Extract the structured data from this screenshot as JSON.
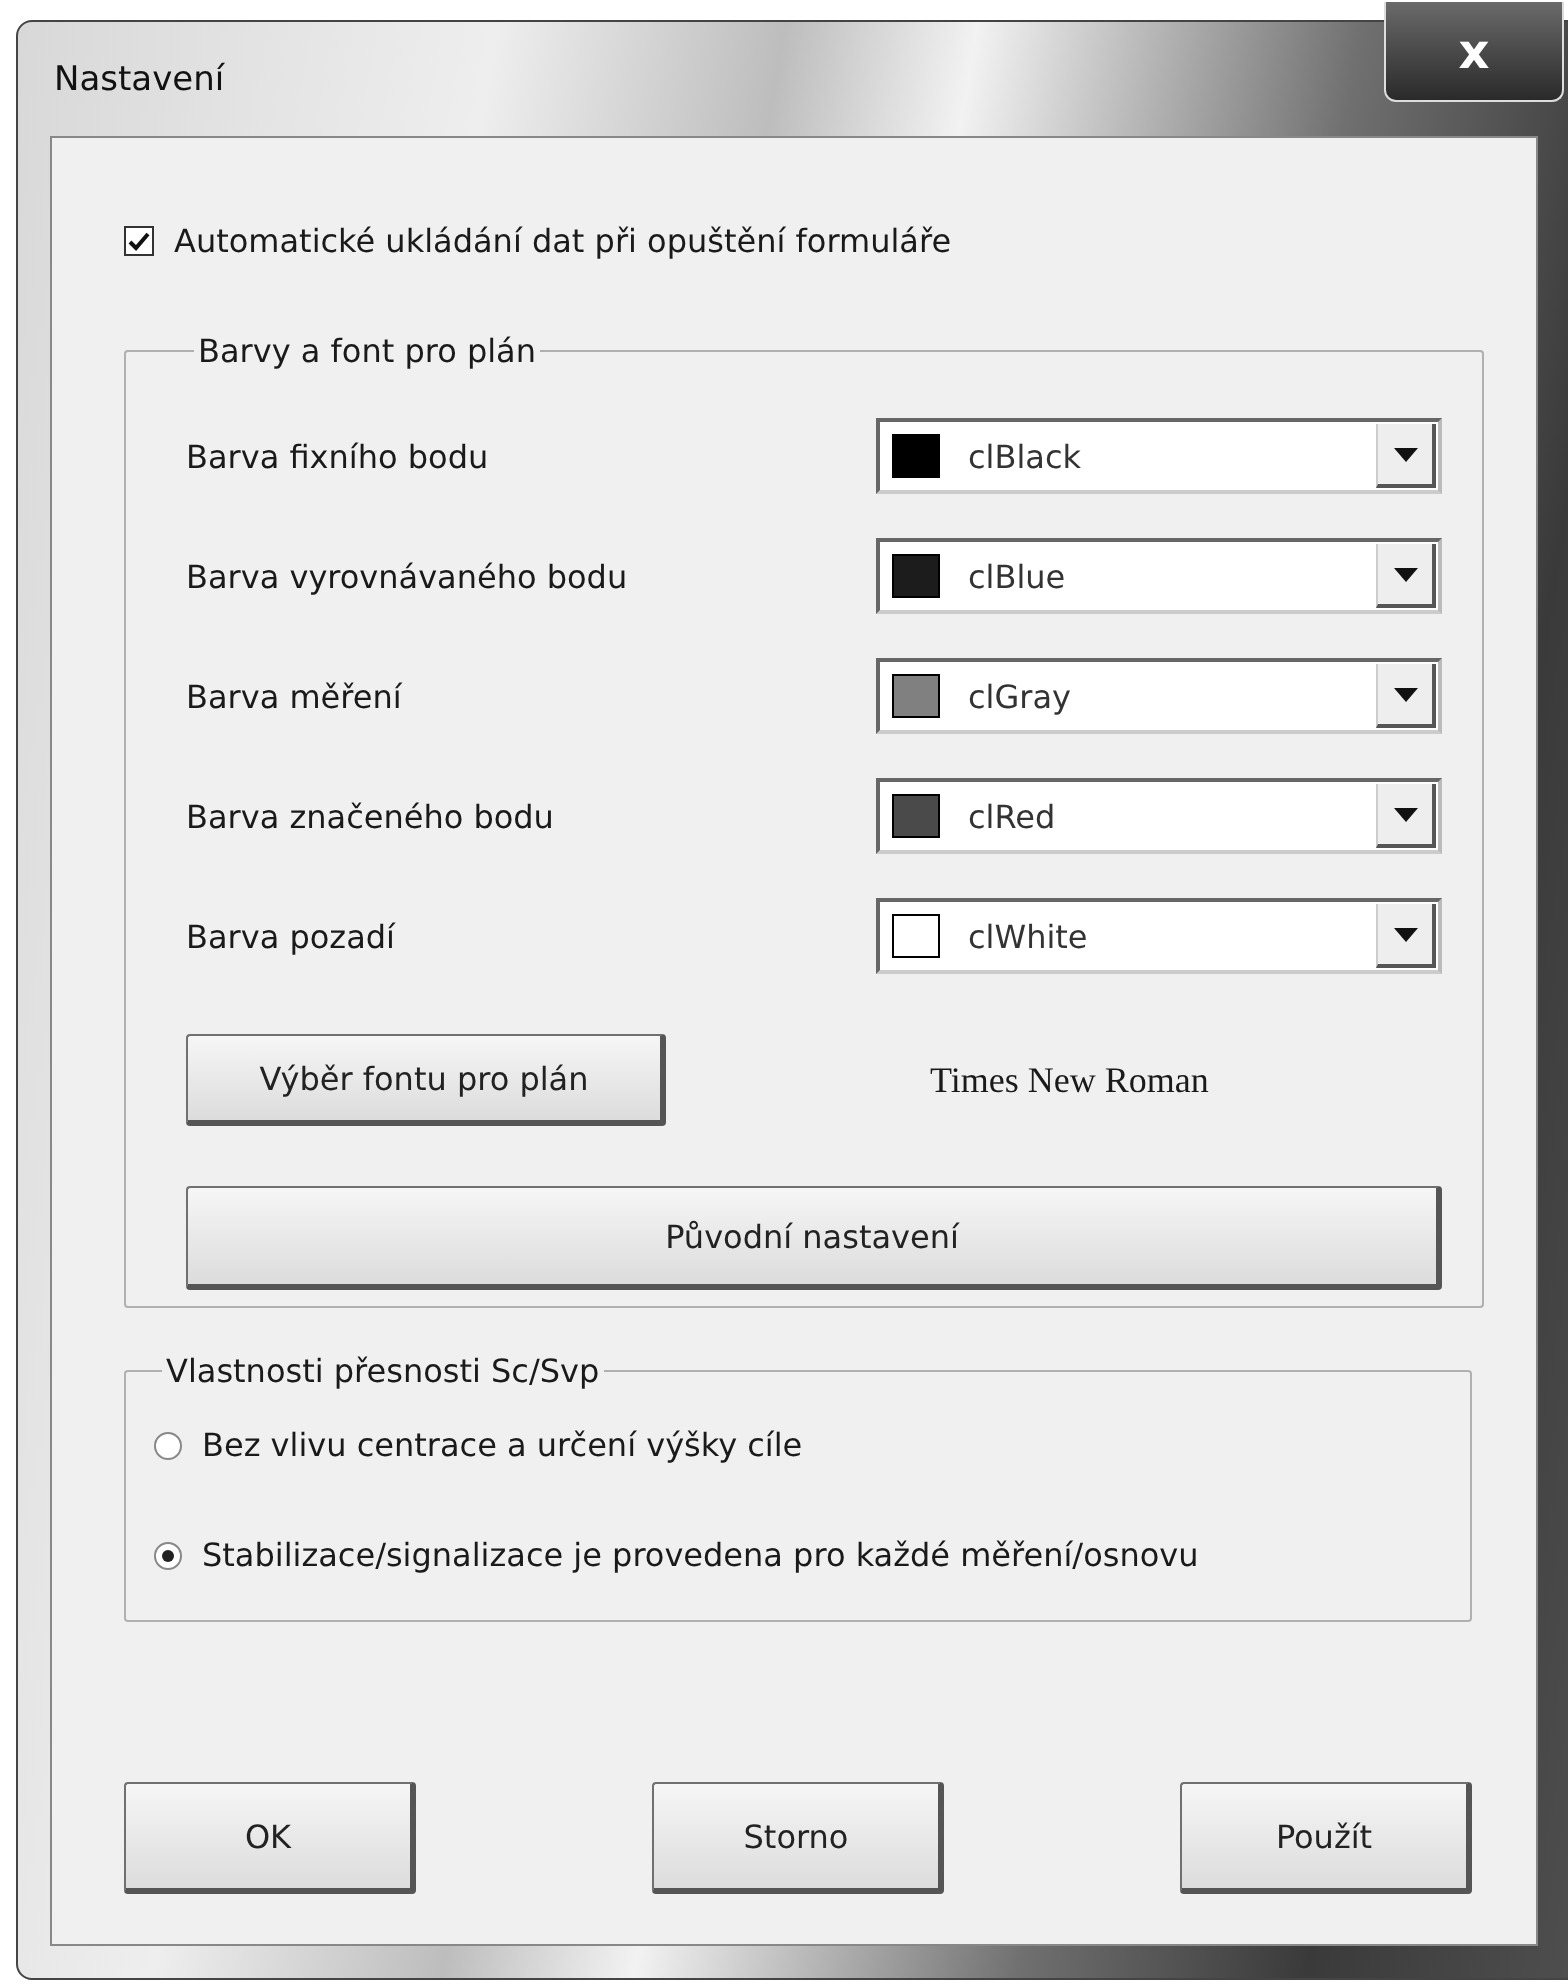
{
  "window": {
    "title": "Nastavení",
    "close": "x"
  },
  "auto_save": {
    "label": "Automatické ukládání dat při opuštění formuláře",
    "checked": true
  },
  "colors_group": {
    "title": "Barvy a font pro plán",
    "rows": [
      {
        "label": "Barva fixního bodu",
        "value": "clBlack",
        "color": "#000000"
      },
      {
        "label": "Barva vyrovnávaného bodu",
        "value": "clBlue",
        "color": "#1c1c1c"
      },
      {
        "label": "Barva měření",
        "value": "clGray",
        "color": "#808080"
      },
      {
        "label": "Barva značeného bodu",
        "value": "clRed",
        "color": "#4a4a4a"
      },
      {
        "label": "Barva pozadí",
        "value": "clWhite",
        "color": "#ffffff"
      }
    ],
    "font_button": "Výběr fontu pro plán",
    "font_name": "Times New Roman",
    "reset_button": "Původní nastavení"
  },
  "accuracy_group": {
    "title": "Vlastnosti přesnosti Sc/Svp",
    "options": [
      {
        "label": "Bez vlivu centrace a určení výšky cíle",
        "selected": false
      },
      {
        "label": "Stabilizace/signalizace je provedena pro každé měření/osnovu",
        "selected": true
      }
    ]
  },
  "buttons": [
    "OK",
    "Storno",
    "Použít"
  ]
}
